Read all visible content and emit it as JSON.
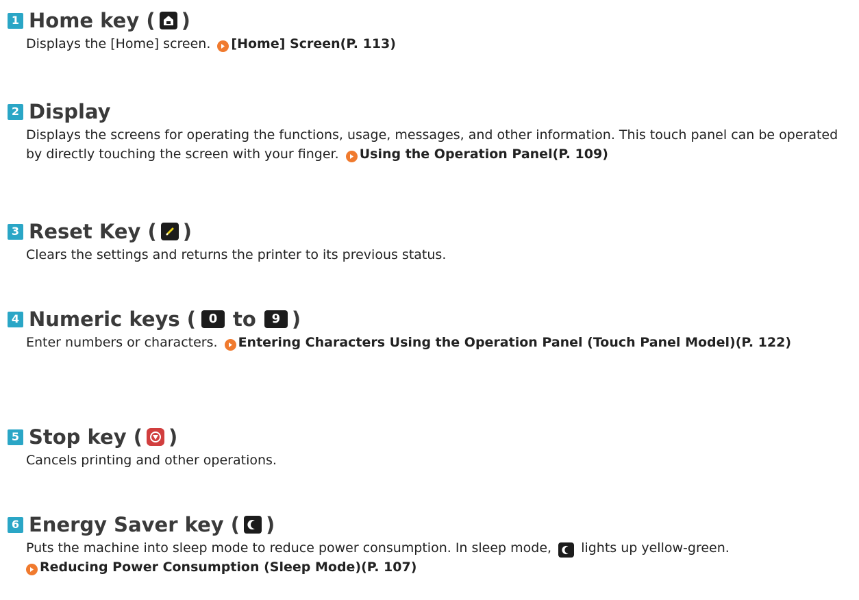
{
  "items": [
    {
      "num": "1",
      "title": "Home key (",
      "close": ")",
      "desc": "Displays the [Home] screen.",
      "link": "[Home] Screen(P. 113)"
    },
    {
      "num": "2",
      "title": "Display",
      "desc": "Displays the screens for operating the functions, usage, messages, and other information. This touch panel can be operated by directly touching the screen with your finger.",
      "link": "Using the Operation Panel(P. 109)"
    },
    {
      "num": "3",
      "title": "Reset Key (",
      "close": ")",
      "desc": "Clears the settings and returns the printer to its previous status."
    },
    {
      "num": "4",
      "title": "Numeric keys (",
      "key_start": "0",
      "to": "to",
      "key_end": "9",
      "close": ")",
      "desc": "Enter numbers or characters.",
      "link": "Entering Characters Using the Operation Panel (Touch Panel Model)(P. 122)"
    },
    {
      "num": "5",
      "title": "Stop key (",
      "close": ")",
      "desc": "Cancels printing and other operations."
    },
    {
      "num": "6",
      "title": "Energy Saver key (",
      "close": ")",
      "desc_before": "Puts the machine into sleep mode to reduce power consumption. In sleep mode,",
      "desc_after": "lights up yellow-green.",
      "link": "Reducing Power Consumption (Sleep Mode)(P. 107)"
    }
  ],
  "colors": {
    "number_badge": "#2aa6c6",
    "link_arrow": "#f07a2e",
    "stop_key": "#d13e3e"
  },
  "icons": [
    "home-icon",
    "reset-icon",
    "stop-icon",
    "energy-saver-icon",
    "link-arrow-icon"
  ]
}
